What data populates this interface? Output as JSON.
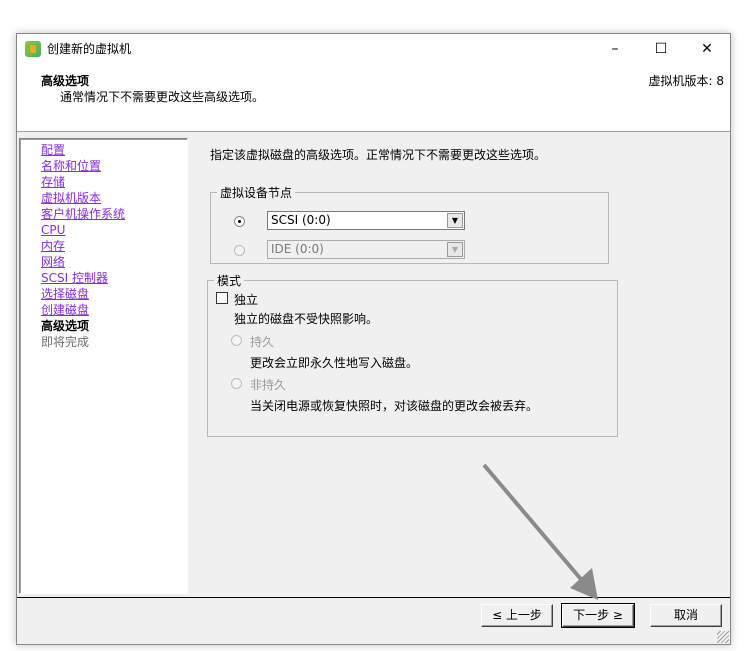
{
  "window": {
    "title": "创建新的虚拟机",
    "minimize_icon": "minimize-icon",
    "maximize_icon": "maximize-icon",
    "close_icon": "close-icon"
  },
  "header": {
    "title": "高级选项",
    "subtitle": "通常情况下不需要更改这些高级选项。",
    "version": "虚拟机版本: 8"
  },
  "nav": {
    "items": [
      {
        "label": "配置",
        "state": "link"
      },
      {
        "label": "名称和位置",
        "state": "link"
      },
      {
        "label": "存储",
        "state": "link"
      },
      {
        "label": "虚拟机版本",
        "state": "link"
      },
      {
        "label": "客户机操作系统",
        "state": "link"
      },
      {
        "label": "CPU",
        "state": "link"
      },
      {
        "label": "内存",
        "state": "link"
      },
      {
        "label": "网络",
        "state": "link"
      },
      {
        "label": "SCSI 控制器",
        "state": "link"
      },
      {
        "label": "选择磁盘",
        "state": "link"
      },
      {
        "label": "创建磁盘",
        "state": "link"
      },
      {
        "label": "高级选项",
        "state": "current"
      },
      {
        "label": "即将完成",
        "state": "disabled"
      }
    ]
  },
  "main": {
    "description": "指定该虚拟磁盘的高级选项。正常情况下不需要更改这些选项。",
    "device_node": {
      "legend": "虚拟设备节点",
      "scsi_value": "SCSI (0:0)",
      "scsi_selected": true,
      "ide_value": "IDE (0:0)",
      "ide_selected": false
    },
    "mode": {
      "legend": "模式",
      "independent_label": "独立",
      "independent_checked": false,
      "independent_desc": "独立的磁盘不受快照影响。",
      "persistent_label": "持久",
      "persistent_desc": "更改会立即永久性地写入磁盘。",
      "nonpersistent_label": "非持久",
      "nonpersistent_desc": "当关闭电源或恢复快照时，对该磁盘的更改会被丢弃。"
    }
  },
  "footer": {
    "back": "≤ 上一步",
    "next": "下一步 ≥",
    "cancel": "取消"
  },
  "colors": {
    "link": "#8a2be2",
    "annotation_arrow": "#8a8a8a"
  }
}
